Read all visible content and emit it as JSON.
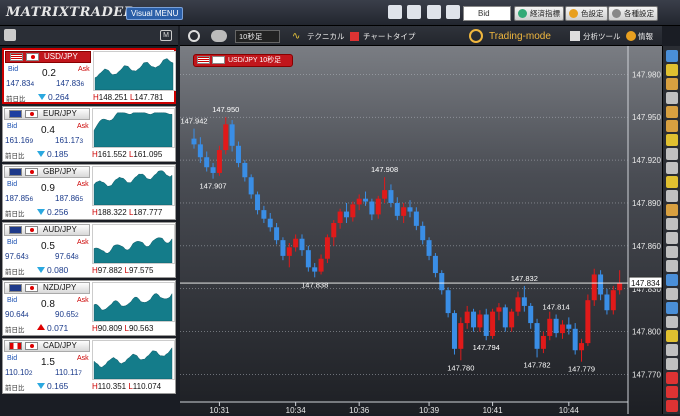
{
  "app": {
    "logo": "MATRIXTRADER",
    "menu_label": "Visual MENU"
  },
  "toolbar": {
    "bid_select": "Bid",
    "econ_label": "経済指標",
    "color_label": "色設定",
    "settings_label": "各種設定",
    "timeframe": "10秒足",
    "technical_label": "テクニカル",
    "charttype_label": "チャートタイプ",
    "trading_mode": "Trading-mode",
    "analysis_label": "分析ツール",
    "info_label": "情報",
    "left_badge": "M"
  },
  "chart_title": "USD/JPY 10秒足",
  "panels": [
    {
      "pair": "USD/JPY",
      "spread": "0.2",
      "bid_main": "147.83",
      "bid_small": "4",
      "ask_main": "147.83",
      "ask_small": "6",
      "change": "0.264",
      "dir": "down",
      "high": "148.251",
      "low": "147.781",
      "flag1": "us"
    },
    {
      "pair": "EUR/JPY",
      "spread": "0.4",
      "bid_main": "161.16",
      "bid_small": "9",
      "ask_main": "161.17",
      "ask_small": "3",
      "change": "0.185",
      "dir": "down",
      "high": "161.552",
      "low": "161.095",
      "flag1": "eu"
    },
    {
      "pair": "GBP/JPY",
      "spread": "0.9",
      "bid_main": "187.85",
      "bid_small": "6",
      "ask_main": "187.86",
      "ask_small": "5",
      "change": "0.256",
      "dir": "down",
      "high": "188.322",
      "low": "187.777",
      "flag1": "gb"
    },
    {
      "pair": "AUD/JPY",
      "spread": "0.5",
      "bid_main": "97.64",
      "bid_small": "3",
      "ask_main": "97.64",
      "ask_small": "8",
      "change": "0.080",
      "dir": "down",
      "high": "97.882",
      "low": "97.575",
      "flag1": "au"
    },
    {
      "pair": "NZD/JPY",
      "spread": "0.8",
      "bid_main": "90.64",
      "bid_small": "4",
      "ask_main": "90.65",
      "ask_small": "2",
      "change": "0.071",
      "dir": "up",
      "high": "90.809",
      "low": "90.563",
      "flag1": "nz"
    },
    {
      "pair": "CAD/JPY",
      "spread": "1.5",
      "bid_main": "110.10",
      "bid_small": "2",
      "ask_main": "110.11",
      "ask_small": "7",
      "change": "0.165",
      "dir": "down",
      "high": "110.351",
      "low": "110.074",
      "flag1": "ca"
    }
  ],
  "panel_labels": {
    "bid": "Bid",
    "ask": "Ask",
    "prev": "前日比",
    "high_prefix": "H",
    "low_prefix": "L"
  },
  "chart_data": {
    "type": "candlestick",
    "ylim": [
      147.755,
      147.99
    ],
    "yticks": [
      "147.980",
      "147.950",
      "147.920",
      "147.890",
      "147.860",
      "147.830",
      "147.800",
      "147.770"
    ],
    "xticks": [
      "10:31",
      "10:34",
      "10:36",
      "10:39",
      "10:41",
      "10:44"
    ],
    "current_price": "147.834",
    "annotations": [
      "147.942",
      "147.950",
      "147.907",
      "147.908",
      "147.838",
      "147.832",
      "147.814",
      "147.794",
      "147.780",
      "147.782",
      "147.779"
    ],
    "candles": [
      [
        147.935,
        147.942,
        147.928,
        147.931
      ],
      [
        147.931,
        147.936,
        147.918,
        147.922
      ],
      [
        147.922,
        147.926,
        147.912,
        147.915
      ],
      [
        147.915,
        147.918,
        147.907,
        147.911
      ],
      [
        147.911,
        147.93,
        147.909,
        147.927
      ],
      [
        147.927,
        147.95,
        147.924,
        147.945
      ],
      [
        147.945,
        147.948,
        147.926,
        147.93
      ],
      [
        147.93,
        147.933,
        147.915,
        147.918
      ],
      [
        147.918,
        147.92,
        147.905,
        147.908
      ],
      [
        147.908,
        147.91,
        147.893,
        147.896
      ],
      [
        147.896,
        147.898,
        147.882,
        147.885
      ],
      [
        147.885,
        147.888,
        147.876,
        147.879
      ],
      [
        147.879,
        147.883,
        147.87,
        147.873
      ],
      [
        147.873,
        147.876,
        147.861,
        147.864
      ],
      [
        147.864,
        147.866,
        147.85,
        147.853
      ],
      [
        147.853,
        147.862,
        147.845,
        147.859
      ],
      [
        147.859,
        147.868,
        147.856,
        147.865
      ],
      [
        147.865,
        147.868,
        147.853,
        147.857
      ],
      [
        147.857,
        147.86,
        147.842,
        147.845
      ],
      [
        147.845,
        147.848,
        147.838,
        147.842
      ],
      [
        147.842,
        147.854,
        147.84,
        147.851
      ],
      [
        147.851,
        147.868,
        147.848,
        147.866
      ],
      [
        147.866,
        147.878,
        147.86,
        147.876
      ],
      [
        147.876,
        147.886,
        147.872,
        147.884
      ],
      [
        147.884,
        147.89,
        147.876,
        147.88
      ],
      [
        147.88,
        147.891,
        147.877,
        147.889
      ],
      [
        147.889,
        147.896,
        147.885,
        147.893
      ],
      [
        147.893,
        147.898,
        147.888,
        147.891
      ],
      [
        147.891,
        147.893,
        147.878,
        147.882
      ],
      [
        147.882,
        147.895,
        147.879,
        147.893
      ],
      [
        147.893,
        147.908,
        147.89,
        147.899
      ],
      [
        147.899,
        147.903,
        147.887,
        147.89
      ],
      [
        147.89,
        147.894,
        147.878,
        147.881
      ],
      [
        147.881,
        147.89,
        147.876,
        147.887
      ],
      [
        147.887,
        147.892,
        147.88,
        147.884
      ],
      [
        147.884,
        147.887,
        147.871,
        147.874
      ],
      [
        147.874,
        147.877,
        147.861,
        147.864
      ],
      [
        147.864,
        147.866,
        147.85,
        147.853
      ],
      [
        147.853,
        147.855,
        147.838,
        147.841
      ],
      [
        147.841,
        147.843,
        147.826,
        147.829
      ],
      [
        147.829,
        147.831,
        147.81,
        147.813
      ],
      [
        147.813,
        147.815,
        147.784,
        147.788
      ],
      [
        147.788,
        147.81,
        147.78,
        147.806
      ],
      [
        147.806,
        147.818,
        147.802,
        147.814
      ],
      [
        147.814,
        147.816,
        147.8,
        147.803
      ],
      [
        147.803,
        147.815,
        147.8,
        147.812
      ],
      [
        147.812,
        147.816,
        147.794,
        147.797
      ],
      [
        147.797,
        147.816,
        147.795,
        147.814
      ],
      [
        147.814,
        147.82,
        147.808,
        147.817
      ],
      [
        147.817,
        147.819,
        147.8,
        147.803
      ],
      [
        147.803,
        147.816,
        147.8,
        147.814
      ],
      [
        147.814,
        147.828,
        147.811,
        147.824
      ],
      [
        147.824,
        147.832,
        147.814,
        147.818
      ],
      [
        147.818,
        147.82,
        147.802,
        147.806
      ],
      [
        147.806,
        147.809,
        147.782,
        147.788
      ],
      [
        147.788,
        147.8,
        147.785,
        147.797
      ],
      [
        147.797,
        147.814,
        147.794,
        147.809
      ],
      [
        147.809,
        147.812,
        147.796,
        147.799
      ],
      [
        147.799,
        147.808,
        147.795,
        147.805
      ],
      [
        147.805,
        147.81,
        147.798,
        147.802
      ],
      [
        147.802,
        147.806,
        147.784,
        147.787
      ],
      [
        147.787,
        147.795,
        147.779,
        147.792
      ],
      [
        147.792,
        147.826,
        147.79,
        147.822
      ],
      [
        147.822,
        147.844,
        147.818,
        147.84
      ],
      [
        147.84,
        147.843,
        147.822,
        147.826
      ],
      [
        147.826,
        147.83,
        147.812,
        147.815
      ],
      [
        147.815,
        147.832,
        147.812,
        147.829
      ],
      [
        147.829,
        147.843,
        147.826,
        147.834
      ]
    ],
    "colors": {
      "up": "#e01a1a",
      "down": "#3a8ee6",
      "grid": "#b8bcc4",
      "axis_text": "#e8e8e8"
    }
  }
}
